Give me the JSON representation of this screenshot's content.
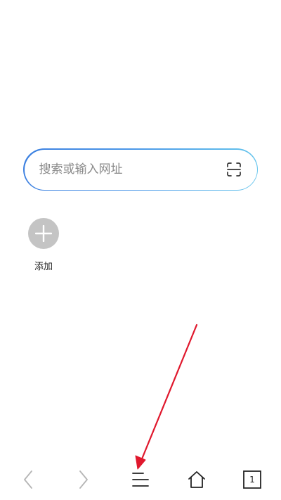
{
  "search": {
    "placeholder": "搜索或输入网址",
    "value": "",
    "scan_icon": "scan-icon",
    "border_gradient": [
      "#3b7fe0",
      "#63c4ec"
    ]
  },
  "shortcuts": {
    "add_label": "添加",
    "add_icon": "plus-icon",
    "add_bg_color": "#c4c4c4"
  },
  "toolbar": {
    "back_icon": "chevron-left-icon",
    "forward_icon": "chevron-right-icon",
    "menu_icon": "menu-icon",
    "home_icon": "home-icon",
    "tabs_icon": "tabs-icon",
    "tab_count": "1",
    "disabled_color": "#b5b5b5",
    "active_color": "#222222"
  },
  "annotation": {
    "type": "arrow",
    "color": "#e0182d",
    "points_to": "menu-button"
  }
}
